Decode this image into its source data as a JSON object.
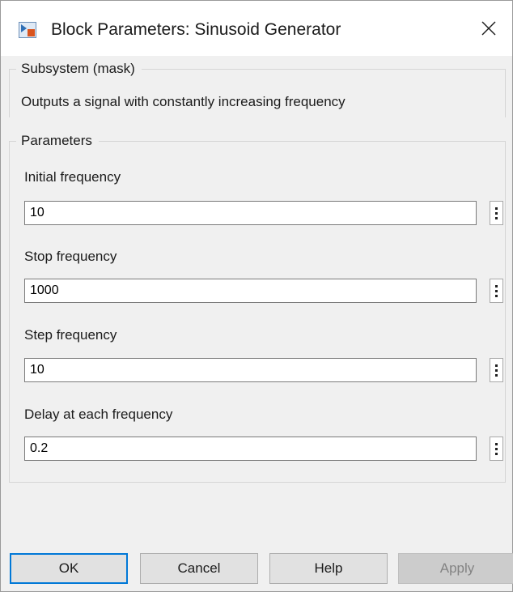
{
  "window": {
    "title": "Block Parameters: Sinusoid Generator"
  },
  "mask": {
    "legend": "Subsystem (mask)",
    "description": "Outputs a signal with constantly increasing frequency"
  },
  "parameters": {
    "legend": "Parameters",
    "items": [
      {
        "label": "Initial frequency",
        "value": "10"
      },
      {
        "label": "Stop frequency",
        "value": "1000"
      },
      {
        "label": "Step frequency",
        "value": "10"
      },
      {
        "label": "Delay at each frequency",
        "value": "0.2"
      }
    ]
  },
  "buttons": {
    "ok": "OK",
    "cancel": "Cancel",
    "help": "Help",
    "apply": "Apply"
  },
  "colors": {
    "accent": "#0078d7",
    "window_bg": "#f0f0f0",
    "titlebar_bg": "#ffffff",
    "button_bg": "#e1e1e1",
    "disabled_bg": "#cccccc",
    "disabled_text": "#838383"
  },
  "icons": {
    "app": "simulink-block-icon",
    "close": "close-icon",
    "options": "vertical-ellipsis-icon"
  }
}
